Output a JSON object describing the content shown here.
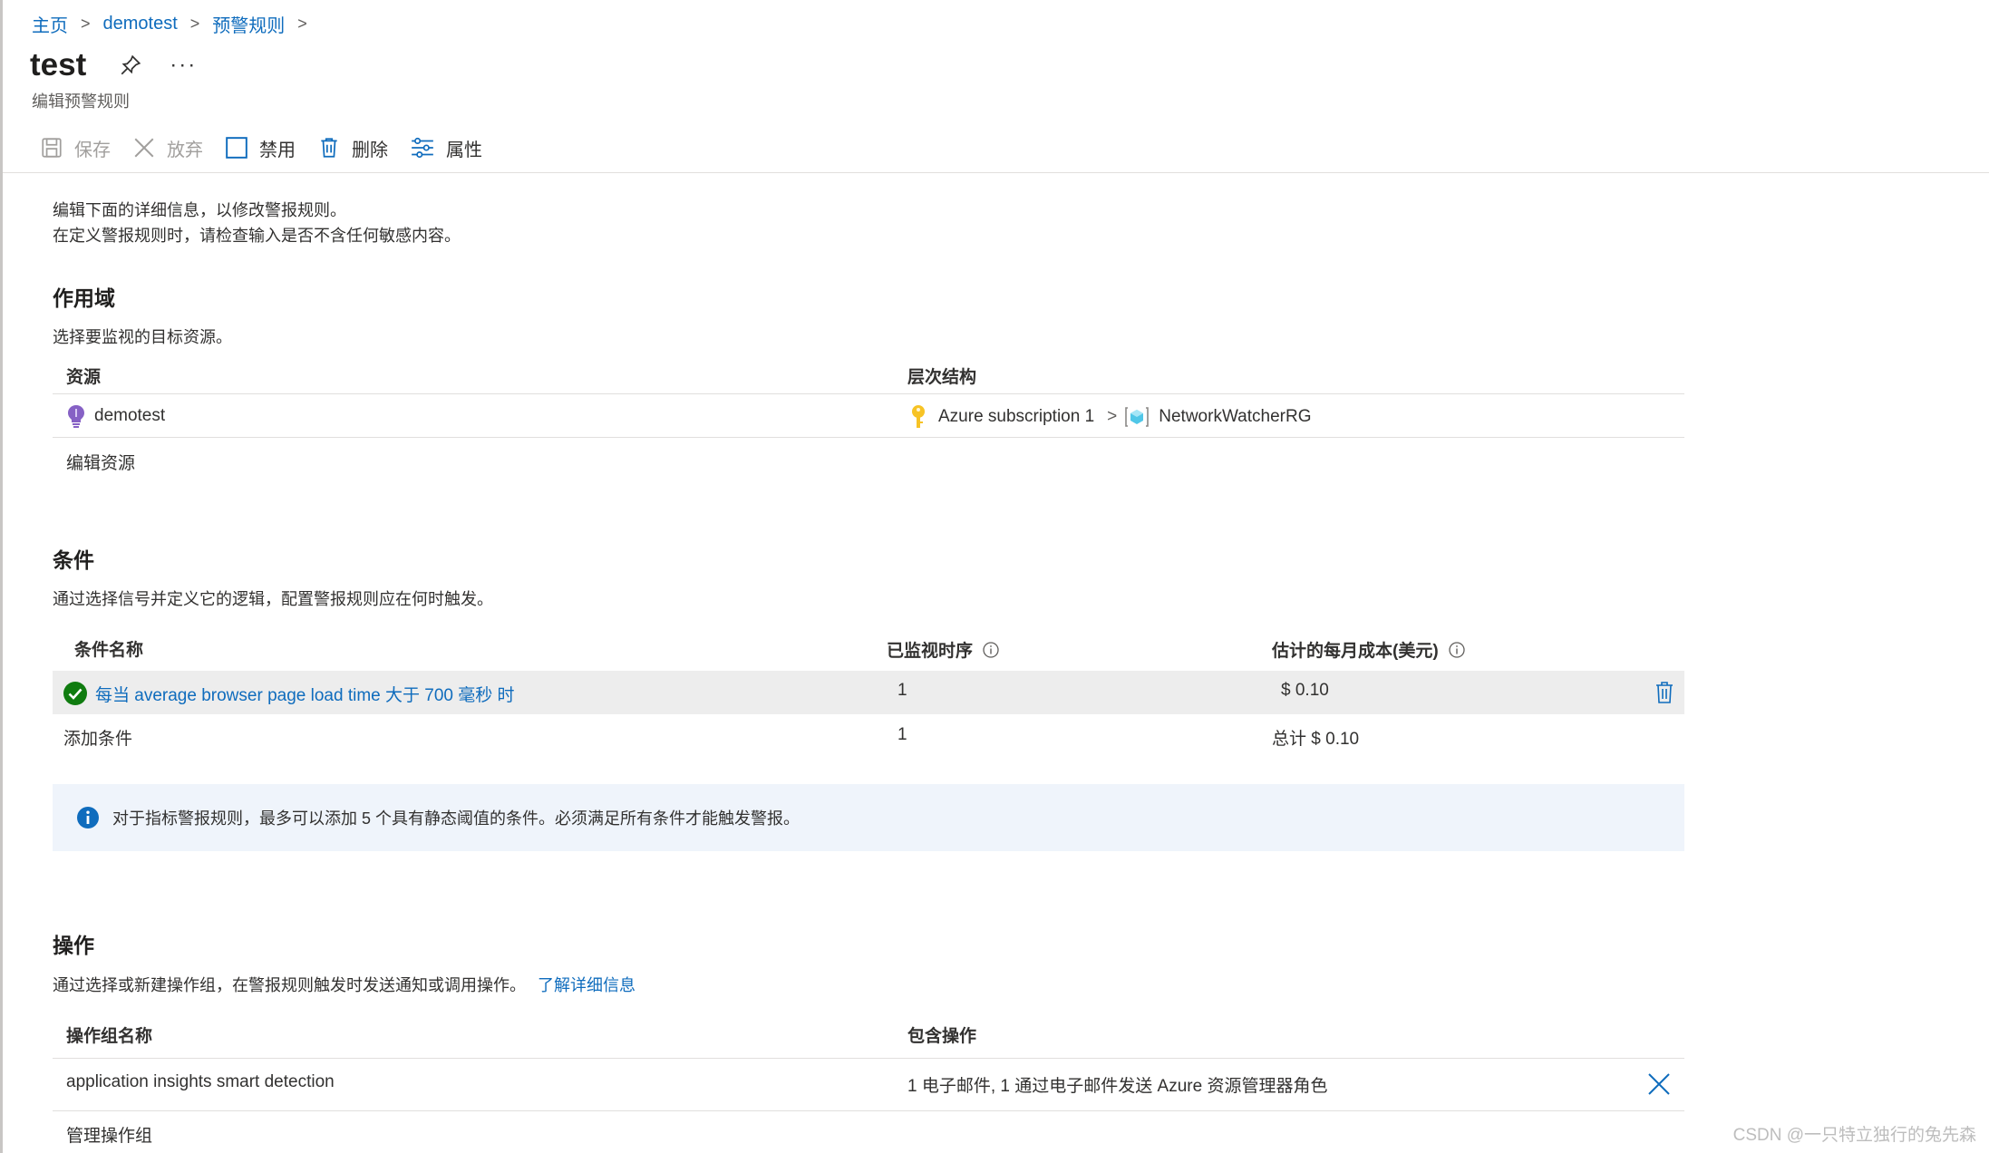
{
  "breadcrumb": {
    "items": [
      "主页",
      "demotest",
      "预警规则"
    ]
  },
  "header": {
    "title": "test",
    "subtitle": "编辑预警规则",
    "more": "···"
  },
  "toolbar": {
    "save": "保存",
    "discard": "放弃",
    "disable": "禁用",
    "delete": "删除",
    "properties": "属性"
  },
  "intro": {
    "line1": "编辑下面的详细信息，以修改警报规则。",
    "line2": "在定义警报规则时，请检查输入是否不含任何敏感内容。"
  },
  "scope": {
    "title": "作用域",
    "desc": "选择要监视的目标资源。",
    "col_resource": "资源",
    "col_hierarchy": "层次结构",
    "resource_name": "demotest",
    "subscription": "Azure subscription 1",
    "resource_group": "NetworkWatcherRG",
    "edit_link": "编辑资源"
  },
  "conditions": {
    "title": "条件",
    "desc": "通过选择信号并定义它的逻辑，配置警报规则应在何时触发。",
    "col_name": "条件名称",
    "col_series": "已监视时序",
    "col_cost": "估计的每月成本(美元)",
    "row_name": "每当 average browser page load time 大于 700 毫秒 时",
    "row_series": "1",
    "row_cost": "$ 0.10",
    "add_link": "添加条件",
    "total_series": "1",
    "total_cost": "总计 $ 0.10",
    "info": "对于指标警报规则，最多可以添加 5 个具有静态阈值的条件。必须满足所有条件才能触发警报。"
  },
  "actions": {
    "title": "操作",
    "desc": "通过选择或新建操作组，在警报规则触发时发送通知或调用操作。",
    "learn_more": "了解详细信息",
    "col_group": "操作组名称",
    "col_contains": "包含操作",
    "group_name": "application insights smart detection",
    "group_contains": "1 电子邮件, 1 通过电子邮件发送 Azure 资源管理器角色",
    "manage_link": "管理操作组"
  },
  "watermark": "CSDN @一只特立独行的兔先森",
  "colors": {
    "link": "#0f6cbd",
    "success": "#107c10",
    "info": "#0f6cbd",
    "disabled": "#a19f9d"
  }
}
